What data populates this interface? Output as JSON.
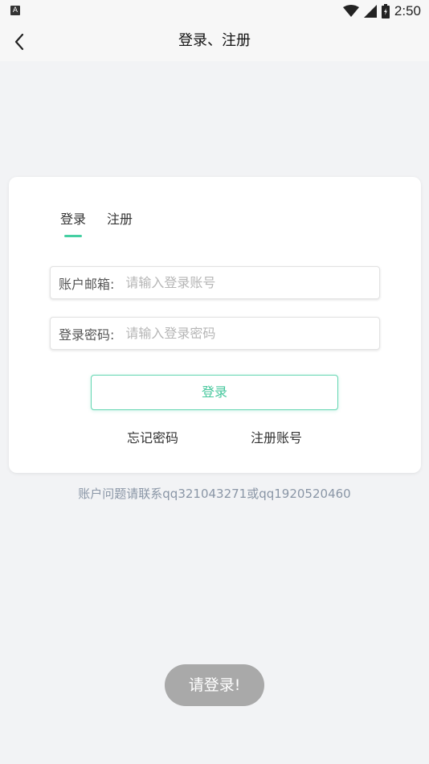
{
  "status_bar": {
    "time": "2:50",
    "left_icon_glyph": "A"
  },
  "app_bar": {
    "title": "登录、注册"
  },
  "login_card": {
    "tabs": [
      {
        "label": "登录",
        "active": true
      },
      {
        "label": "注册",
        "active": false
      }
    ],
    "account_field": {
      "label": "账户邮箱:",
      "value": "",
      "placeholder": "请输入登录账号"
    },
    "password_field": {
      "label": "登录密码:",
      "value": "",
      "placeholder": "请输入登录密码"
    },
    "login_button_label": "登录",
    "forgot_password_label": "忘记密码",
    "register_account_label": "注册账号"
  },
  "contact_note": "账户问题请联系qq321043271或qq1920520460",
  "toast": "请登录!",
  "colors": {
    "accent": "#45cfa2",
    "background": "#f2f3f5",
    "toast_bg": "#a9a9a9"
  }
}
